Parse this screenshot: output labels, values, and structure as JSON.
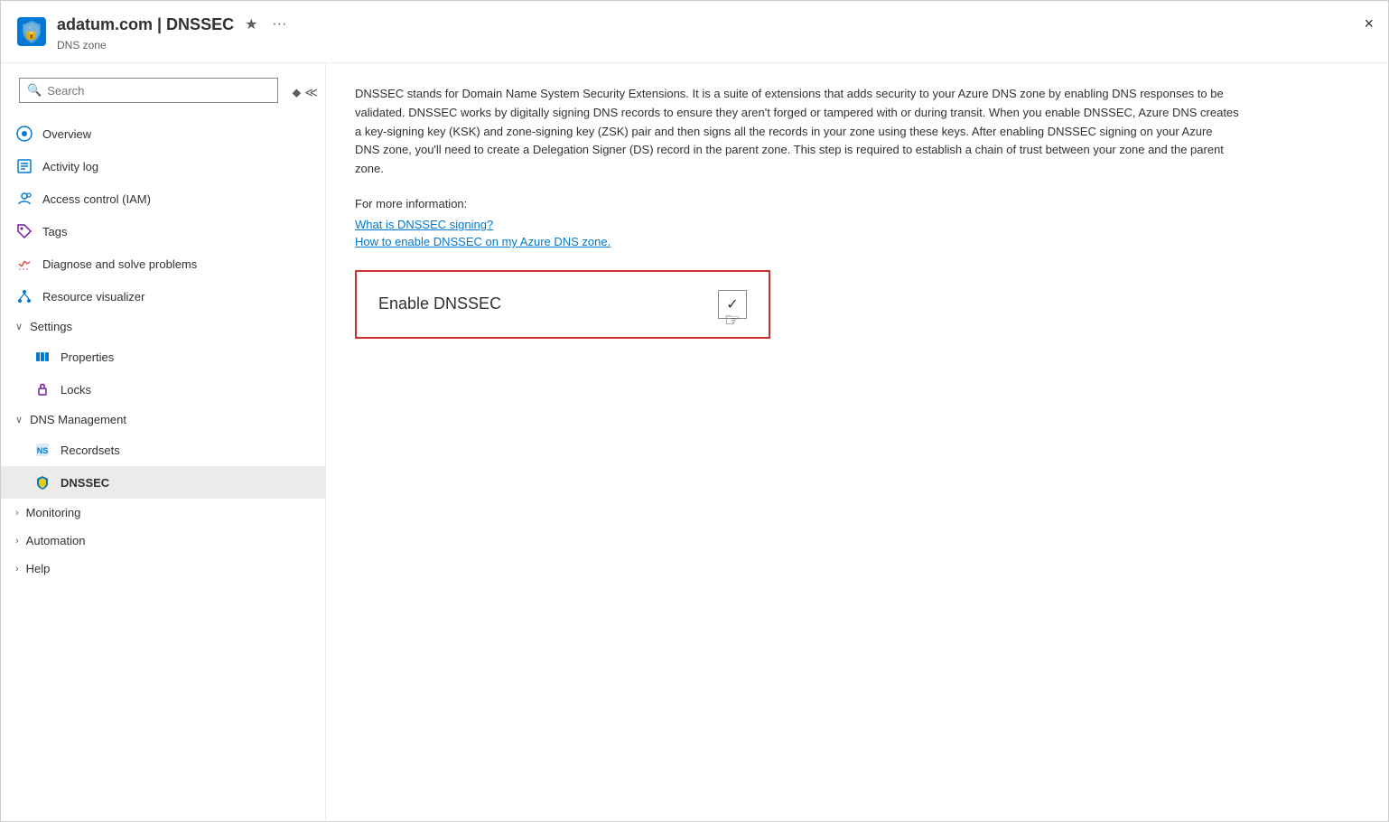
{
  "header": {
    "title": "adatum.com | DNSSEC",
    "subtitle": "DNS zone",
    "favorite_label": "★",
    "more_label": "···",
    "close_label": "×"
  },
  "sidebar": {
    "search_placeholder": "Search",
    "nav_items": [
      {
        "id": "overview",
        "label": "Overview",
        "icon": "overview",
        "indent": false
      },
      {
        "id": "activity-log",
        "label": "Activity log",
        "icon": "activity",
        "indent": false
      },
      {
        "id": "iam",
        "label": "Access control (IAM)",
        "icon": "iam",
        "indent": false
      },
      {
        "id": "tags",
        "label": "Tags",
        "icon": "tags",
        "indent": false
      },
      {
        "id": "diagnose",
        "label": "Diagnose and solve problems",
        "icon": "diagnose",
        "indent": false
      },
      {
        "id": "resource-visualizer",
        "label": "Resource visualizer",
        "icon": "resource",
        "indent": false
      }
    ],
    "sections": [
      {
        "id": "settings",
        "label": "Settings",
        "expanded": true,
        "children": [
          {
            "id": "properties",
            "label": "Properties",
            "icon": "properties"
          },
          {
            "id": "locks",
            "label": "Locks",
            "icon": "locks"
          }
        ]
      },
      {
        "id": "dns-management",
        "label": "DNS Management",
        "expanded": true,
        "children": [
          {
            "id": "recordsets",
            "label": "Recordsets",
            "icon": "recordsets"
          },
          {
            "id": "dnssec",
            "label": "DNSSEC",
            "icon": "dnssec",
            "active": true
          }
        ]
      },
      {
        "id": "monitoring",
        "label": "Monitoring",
        "expanded": false,
        "children": []
      },
      {
        "id": "automation",
        "label": "Automation",
        "expanded": false,
        "children": []
      },
      {
        "id": "help",
        "label": "Help",
        "expanded": false,
        "children": []
      }
    ]
  },
  "main": {
    "description": "DNSSEC stands for Domain Name System Security Extensions. It is a suite of extensions that adds security to your Azure DNS zone by enabling DNS responses to be validated. DNSSEC works by digitally signing DNS records to ensure they aren't forged or tampered with or during transit. When you enable DNSSEC, Azure DNS creates a key-signing key (KSK) and zone-signing key (ZSK) pair and then signs all the records in your zone using these keys. After enabling DNSSEC signing on your Azure DNS zone, you'll need to create a Delegation Signer (DS) record in the parent zone. This step is required to establish a chain of trust between your zone and the parent zone.",
    "for_more_info": "For more information:",
    "link1": "What is DNSSEC signing?",
    "link2": "How to enable DNSSEC on my Azure DNS zone.",
    "enable_label": "Enable DNSSEC"
  }
}
